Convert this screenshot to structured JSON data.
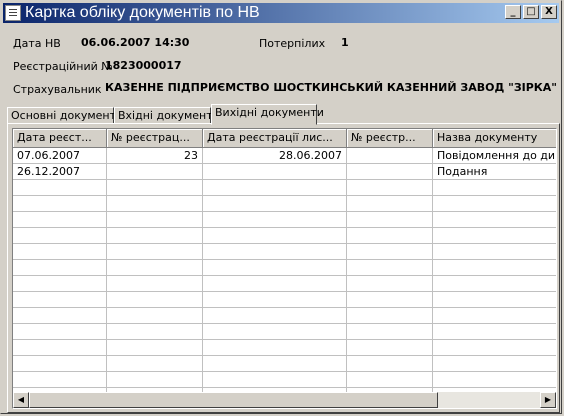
{
  "window": {
    "title": "Картка обліку документів по НВ",
    "controls": {
      "minimize": "_",
      "maximize": "□",
      "close": "X"
    }
  },
  "fields": {
    "date_label": "Дата НВ",
    "date_value": "06.06.2007 14:30",
    "victims_label": "Потерпілих",
    "victims_value": "1",
    "reg_label": "Реєстраційний №",
    "reg_value": "1823000017",
    "insurer_label": "Страхувальник",
    "insurer_value": "КАЗЕННЕ ПІДПРИЄМСТВО ШОСТКИНСЬКИЙ КАЗЕННИЙ ЗАВОД \"ЗІРКА\""
  },
  "tabs": [
    "Основні документи",
    "Вхідні документи",
    "Вихідні документи"
  ],
  "active_tab": 2,
  "table": {
    "columns": [
      "Дата реєст...",
      "№ реєстрац...",
      "Дата реєстрації лис...",
      "№ реєстр...",
      "Назва документу"
    ],
    "rows": [
      [
        "07.06.2007",
        "23",
        "28.06.2007",
        "",
        "Повідомлення до дир"
      ],
      [
        "26.12.2007",
        "",
        "",
        "",
        "Подання"
      ]
    ],
    "empty_rows": 14
  },
  "scrollbar": {
    "left_arrow": "◀",
    "right_arrow": "▶",
    "position": 0.0,
    "visible_fraction": 0.8
  }
}
